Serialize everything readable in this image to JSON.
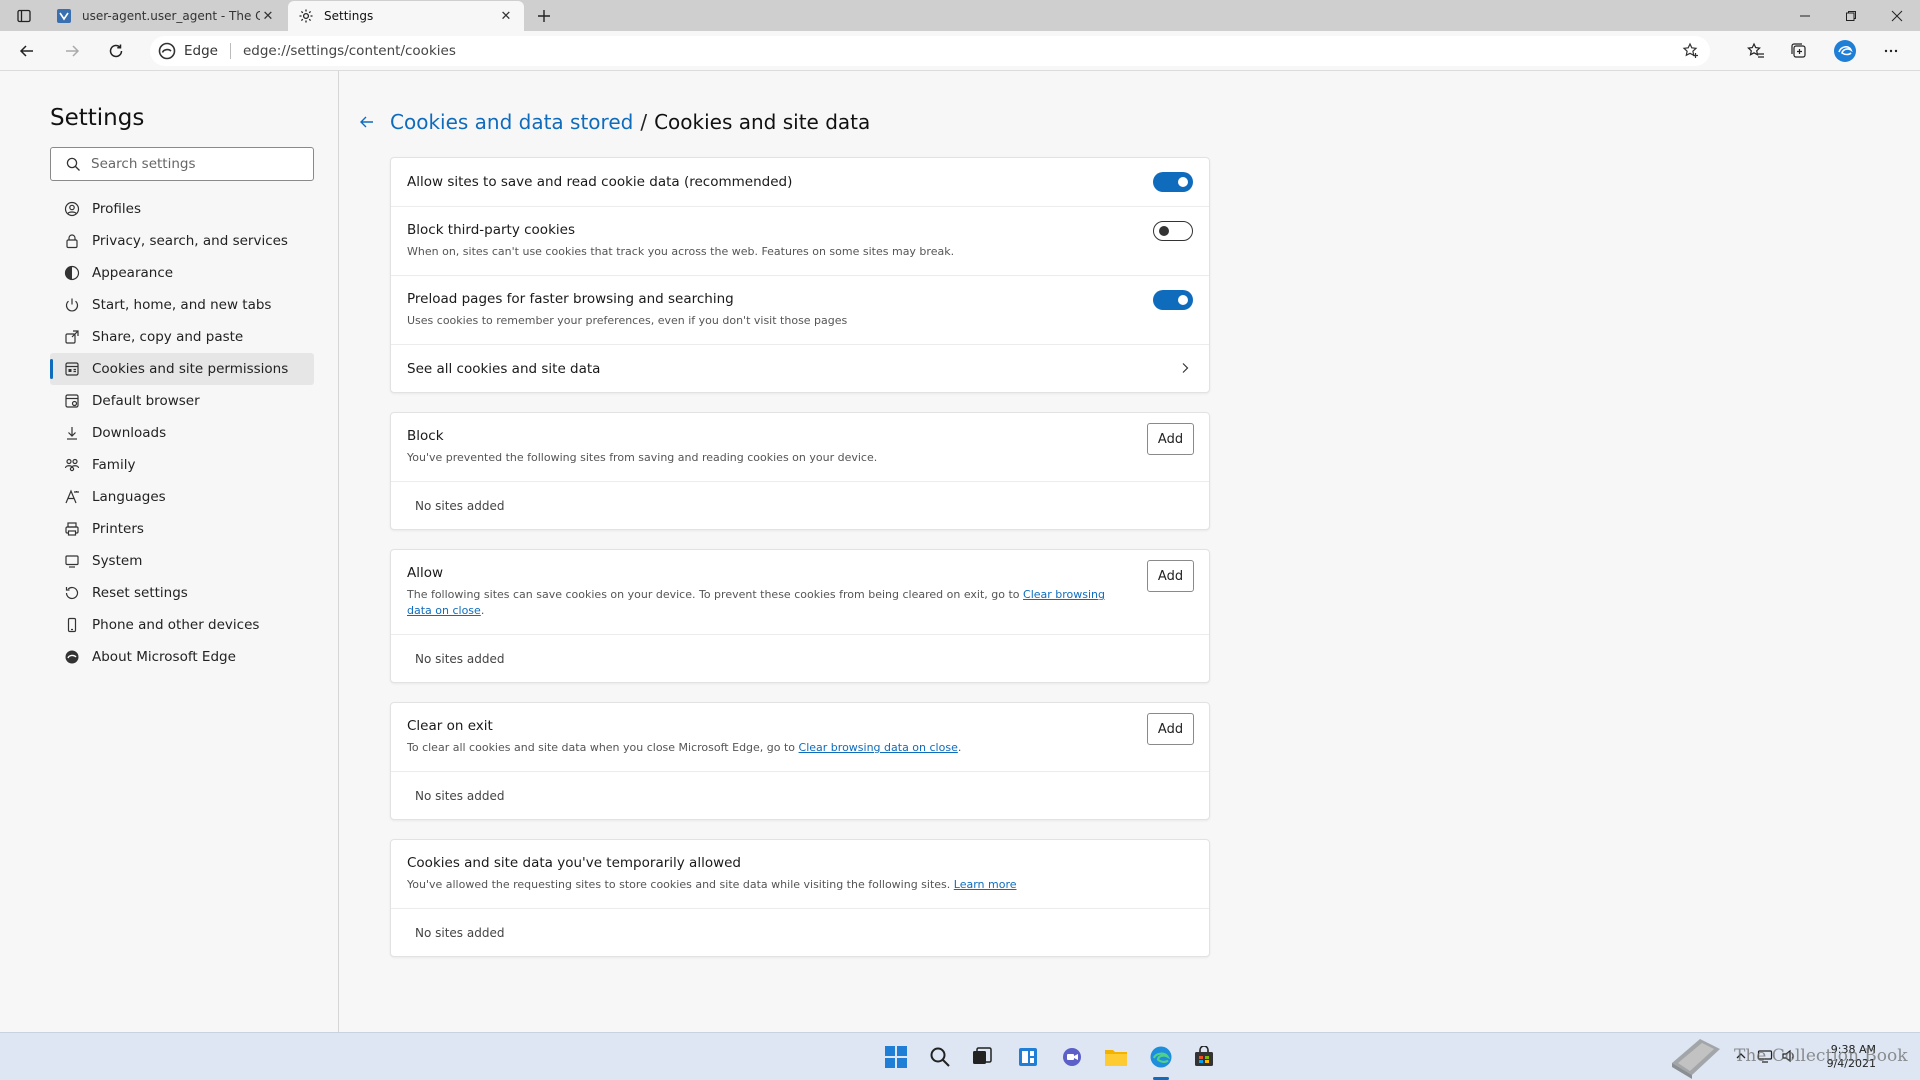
{
  "browser": {
    "tabs": [
      {
        "title": "user-agent.user_agent - The Coll",
        "active": false
      },
      {
        "title": "Settings",
        "active": true
      }
    ],
    "address": {
      "site_label": "Edge",
      "url": "edge://settings/content/cookies"
    }
  },
  "sidebar": {
    "title": "Settings",
    "search_placeholder": "Search settings",
    "items": [
      {
        "label": "Profiles",
        "icon": "profile-icon"
      },
      {
        "label": "Privacy, search, and services",
        "icon": "lock-icon"
      },
      {
        "label": "Appearance",
        "icon": "appearance-icon"
      },
      {
        "label": "Start, home, and new tabs",
        "icon": "power-icon"
      },
      {
        "label": "Share, copy and paste",
        "icon": "share-icon"
      },
      {
        "label": "Cookies and site permissions",
        "icon": "cookies-icon",
        "selected": true
      },
      {
        "label": "Default browser",
        "icon": "browser-icon"
      },
      {
        "label": "Downloads",
        "icon": "download-icon"
      },
      {
        "label": "Family",
        "icon": "family-icon"
      },
      {
        "label": "Languages",
        "icon": "languages-icon"
      },
      {
        "label": "Printers",
        "icon": "printer-icon"
      },
      {
        "label": "System",
        "icon": "system-icon"
      },
      {
        "label": "Reset settings",
        "icon": "reset-icon"
      },
      {
        "label": "Phone and other devices",
        "icon": "phone-icon"
      },
      {
        "label": "About Microsoft Edge",
        "icon": "edge-icon"
      }
    ]
  },
  "breadcrumb": {
    "parent": "Cookies and data stored",
    "separator": "/",
    "current": "Cookies and site data"
  },
  "settings": {
    "allow_save": {
      "title": "Allow sites to save and read cookie data (recommended)",
      "enabled": true
    },
    "block_third_party": {
      "title": "Block third-party cookies",
      "desc": "When on, sites can't use cookies that track you across the web. Features on some sites may break.",
      "enabled": false
    },
    "preload": {
      "title": "Preload pages for faster browsing and searching",
      "desc": "Uses cookies to remember your preferences, even if you don't visit those pages",
      "enabled": true
    },
    "see_all": {
      "title": "See all cookies and site data"
    }
  },
  "lists": {
    "add_label": "Add",
    "empty_label": "No sites added",
    "block": {
      "title": "Block",
      "desc": "You've prevented the following sites from saving and reading cookies on your device."
    },
    "allow": {
      "title": "Allow",
      "desc_prefix": "The following sites can save cookies on your device. To prevent these cookies from being cleared on exit, go to ",
      "desc_link": "Clear browsing data on close",
      "desc_suffix": "."
    },
    "clear_on_exit": {
      "title": "Clear on exit",
      "desc_prefix": "To clear all cookies and site data when you close Microsoft Edge, go to ",
      "desc_link": "Clear browsing data on close",
      "desc_suffix": "."
    },
    "temporarily_allowed": {
      "title": "Cookies and site data you've temporarily allowed",
      "desc_prefix": "You've allowed the requesting sites to store cookies and site data while visiting the following sites. ",
      "desc_link": "Learn more"
    }
  },
  "taskbar": {
    "time": "9:38 AM",
    "date": "9/4/2021",
    "watermark": "The Collection Book"
  },
  "colors": {
    "accent": "#0f6cbd",
    "taskbar": "#dde6f2"
  }
}
